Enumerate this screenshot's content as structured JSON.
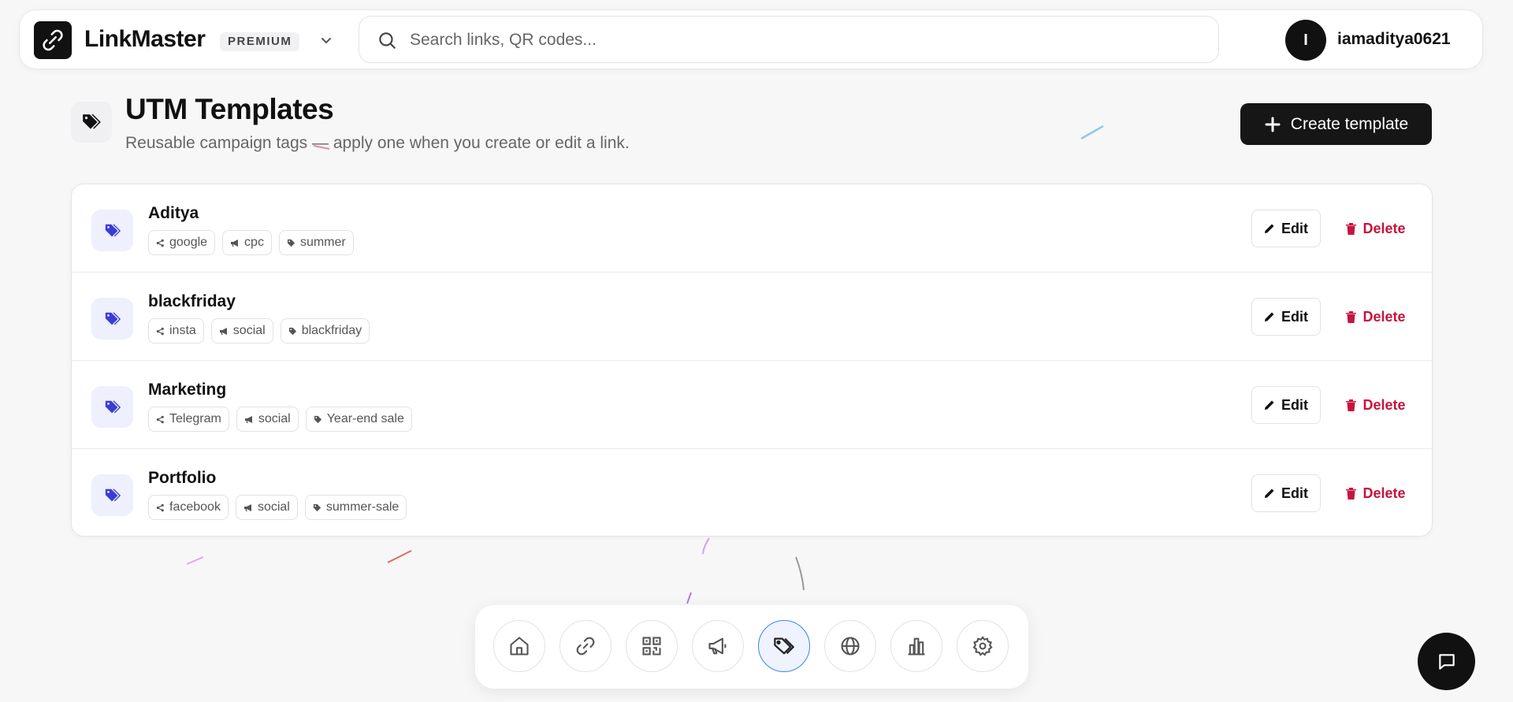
{
  "header": {
    "brand": "LinkMaster",
    "plan_badge": "PREMIUM",
    "search_placeholder": "Search links, QR codes...",
    "avatar_initial": "I",
    "username": "iamaditya0621"
  },
  "page": {
    "title": "UTM Templates",
    "subtitle": "Reusable campaign tags — apply one when you create or edit a link.",
    "create_button": "Create template"
  },
  "templates": [
    {
      "name": "Aditya",
      "source": "google",
      "medium": "cpc",
      "campaign": "summer"
    },
    {
      "name": "blackfriday",
      "source": "insta",
      "medium": "social",
      "campaign": "blackfriday"
    },
    {
      "name": "Marketing",
      "source": "Telegram",
      "medium": "social",
      "campaign": "Year-end sale"
    },
    {
      "name": "Portfolio",
      "source": "facebook",
      "medium": "social",
      "campaign": "summer-sale"
    }
  ],
  "actions": {
    "edit": "Edit",
    "delete": "Delete"
  },
  "dock": {
    "items": [
      {
        "icon": "home-icon"
      },
      {
        "icon": "link-icon"
      },
      {
        "icon": "qr-code-icon"
      },
      {
        "icon": "megaphone-icon"
      },
      {
        "icon": "tags-icon",
        "active": true
      },
      {
        "icon": "globe-icon"
      },
      {
        "icon": "bar-chart-icon"
      },
      {
        "icon": "gear-icon"
      }
    ]
  },
  "colors": {
    "accent_blue": "#3b82f6",
    "tag_icon_indigo": "#3b3bd6",
    "delete_red": "#c8143c",
    "primary_dark": "#161616"
  }
}
